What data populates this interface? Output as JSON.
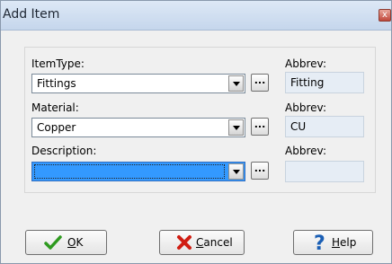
{
  "window": {
    "title": "Add Item",
    "close_label": "x"
  },
  "fields": {
    "item_type": {
      "label": "ItemType:",
      "value": "Fittings",
      "abbrev_label": "Abbrev:",
      "abbrev_value": "Fitting"
    },
    "material": {
      "label": "Material:",
      "value": "Copper",
      "abbrev_label": "Abbrev:",
      "abbrev_value": "CU"
    },
    "description": {
      "label": "Description:",
      "value": "",
      "abbrev_label": "Abbrev:",
      "abbrev_value": ""
    }
  },
  "ellipsis_label": "...",
  "buttons": {
    "ok": {
      "mnemonic": "O",
      "rest": "K"
    },
    "cancel": {
      "mnemonic": "C",
      "rest": "ancel"
    },
    "help": {
      "mnemonic": "H",
      "rest": "elp"
    }
  },
  "colors": {
    "ok_check": "#2e9a1f",
    "cancel_x": "#d01d12",
    "help_q": "#1b5fb5",
    "focus": "#3399ff"
  }
}
